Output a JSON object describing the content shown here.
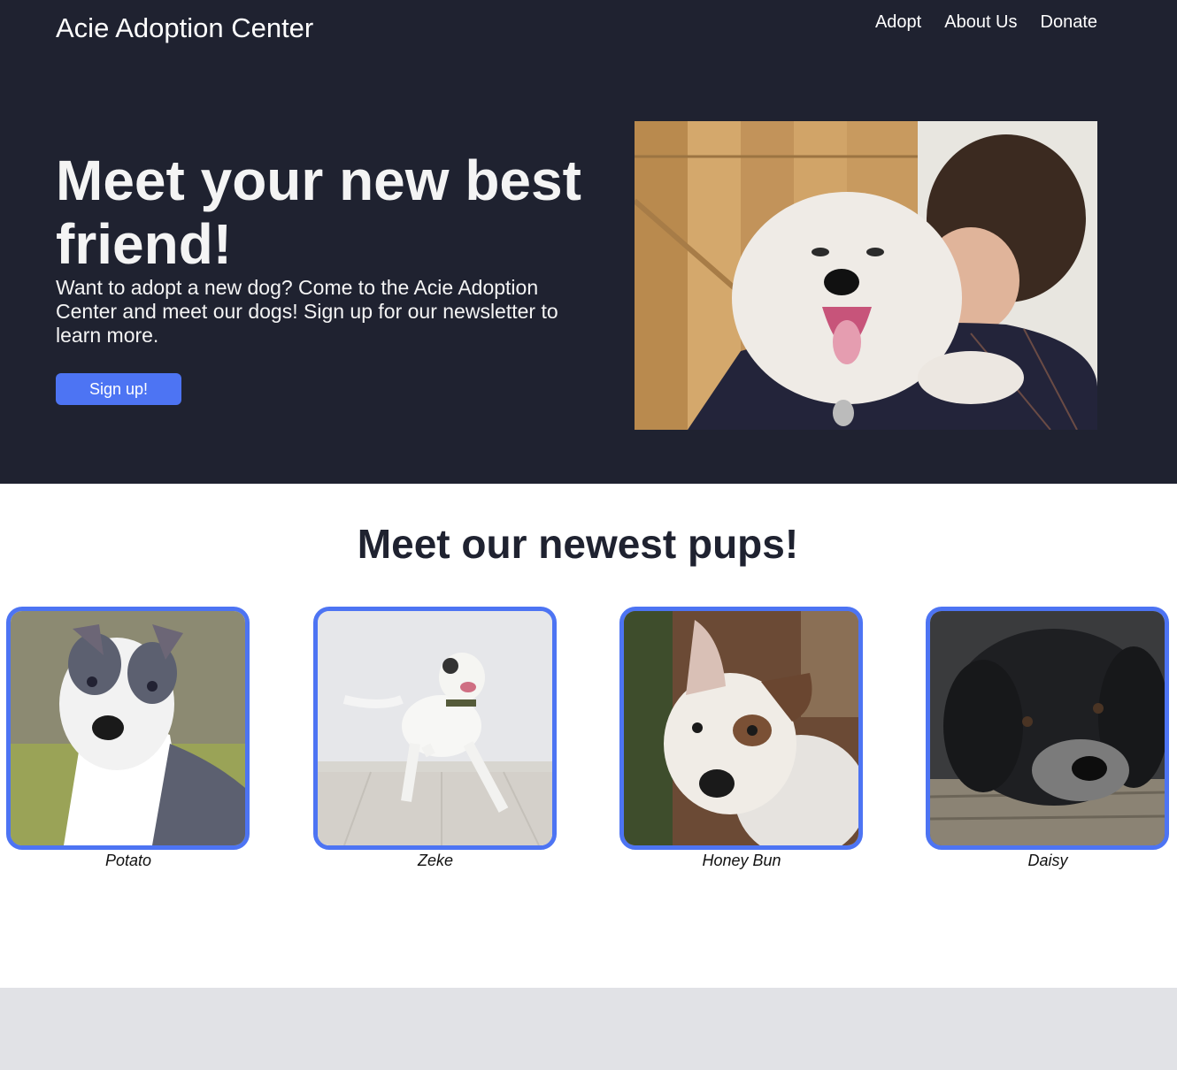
{
  "header": {
    "site_title": "Acie Adoption Center",
    "nav": [
      "Adopt",
      "About Us",
      "Donate"
    ]
  },
  "hero": {
    "heading": "Meet your new best friend!",
    "text": "Want to adopt a new dog? Come to the Acie Adoption Center and meet our dogs! Sign up for our newsletter to learn more.",
    "button_label": "Sign up!"
  },
  "pups": {
    "heading": "Meet our newest pups!",
    "items": [
      {
        "name": "Potato"
      },
      {
        "name": "Zeke"
      },
      {
        "name": "Honey Bun"
      },
      {
        "name": "Daisy"
      }
    ]
  },
  "colors": {
    "hero_bg": "#1f2230",
    "accent": "#4d74f3",
    "footer_bg": "#e1e2e6"
  }
}
